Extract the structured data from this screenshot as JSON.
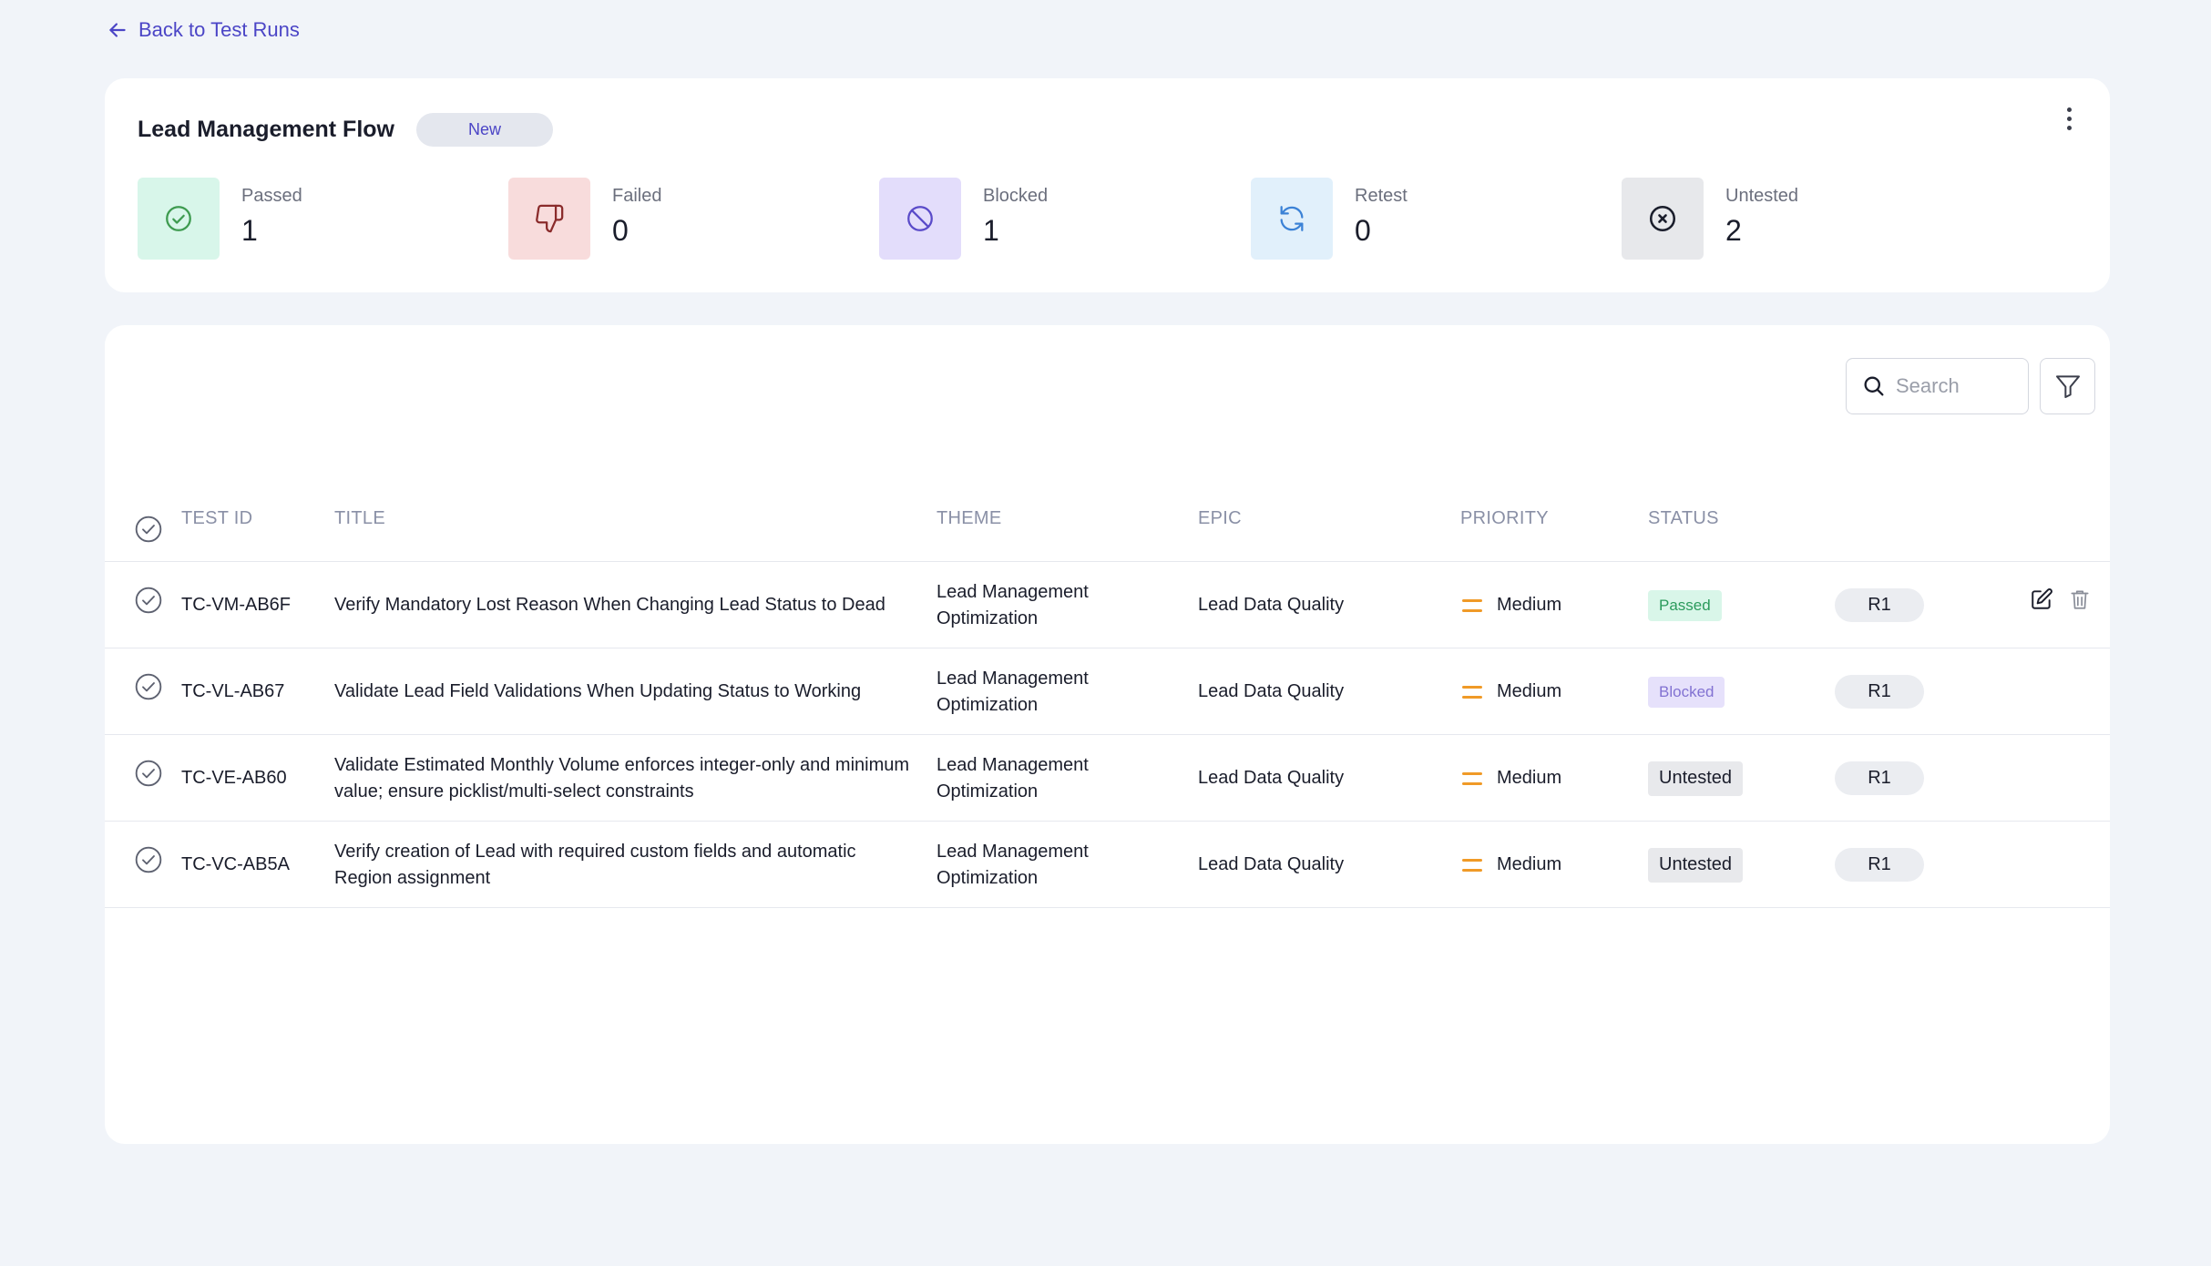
{
  "nav": {
    "back_label": "Back to Test Runs"
  },
  "run": {
    "title": "Lead Management Flow",
    "badge": "New"
  },
  "stats": [
    {
      "label": "Passed",
      "count": "1",
      "icon": "check-circle-icon",
      "bg": "#d8f6ea",
      "color": "#3e9b50"
    },
    {
      "label": "Failed",
      "count": "0",
      "icon": "thumbs-down-icon",
      "bg": "#f8dcdc",
      "color": "#8a2b2b"
    },
    {
      "label": "Blocked",
      "count": "1",
      "icon": "ban-icon",
      "bg": "#e3ddfb",
      "color": "#5a4bc9"
    },
    {
      "label": "Retest",
      "count": "0",
      "icon": "refresh-icon",
      "bg": "#e1f0fb",
      "color": "#3b82d6"
    },
    {
      "label": "Untested",
      "count": "2",
      "icon": "x-circle-icon",
      "bg": "#e7e8eb",
      "color": "#1a1d2b"
    }
  ],
  "toolbar": {
    "search_placeholder": "Search"
  },
  "table": {
    "headers": {
      "test_id": "TEST ID",
      "title": "TITLE",
      "theme": "THEME",
      "epic": "EPIC",
      "priority": "PRIORITY",
      "status": "STATUS"
    },
    "rows": [
      {
        "id": "TC-VM-AB6F",
        "title": "Verify Mandatory Lost Reason When Changing Lead Status to Dead",
        "theme": "Lead Management Optimization",
        "epic": "Lead Data Quality",
        "priority": "Medium",
        "status": "Passed",
        "release": "R1"
      },
      {
        "id": "TC-VL-AB67",
        "title": "Validate Lead Field Validations When Updating Status to Working",
        "theme": "Lead Management Optimization",
        "epic": "Lead Data Quality",
        "priority": "Medium",
        "status": "Blocked",
        "release": "R1"
      },
      {
        "id": "TC-VE-AB60",
        "title": "Validate Estimated Monthly Volume enforces integer-only and minimum value; ensure picklist/multi-select constraints",
        "theme": "Lead Management Optimization",
        "epic": "Lead Data Quality",
        "priority": "Medium",
        "status": "Untested",
        "release": "R1"
      },
      {
        "id": "TC-VC-AB5A",
        "title": "Verify creation of Lead with required custom fields and automatic Region assignment",
        "theme": "Lead Management Optimization",
        "epic": "Lead Data Quality",
        "priority": "Medium",
        "status": "Untested",
        "release": "R1"
      }
    ]
  },
  "colors": {
    "accent": "#4b45c6",
    "priority_medium": "#f09a27",
    "passed": "#2b9b5c",
    "blocked": "#8272d2"
  }
}
